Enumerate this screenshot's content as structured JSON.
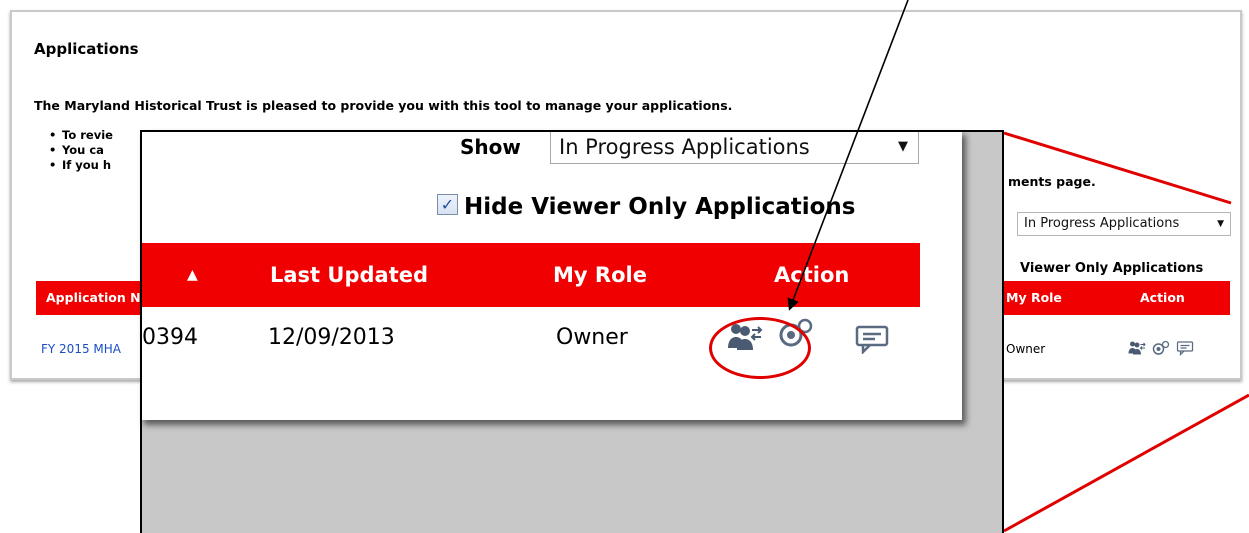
{
  "background": {
    "title": "Applications",
    "intro": "The Maryland Historical Trust is pleased to provide you with this tool to manage your applications.",
    "bullets": [
      "To revie",
      "You ca",
      "If you h"
    ],
    "documents_text": "ments page.",
    "show_select_value": "In Progress Applications",
    "hide_viewer_label": "Viewer Only Applications",
    "table_headers": {
      "application": "Application N",
      "role": "My Role",
      "action": "Action"
    },
    "row": {
      "application": "FY 2015 MHA",
      "role": "Owner"
    }
  },
  "zoom": {
    "show_label": "Show",
    "show_select_value": "In Progress Applications",
    "hide_viewer_checked": "✓",
    "hide_viewer_label": "Hide Viewer Only Applications",
    "table_headers": {
      "sort": "▲",
      "last_updated": "Last Updated",
      "role": "My Role",
      "action": "Action"
    },
    "row": {
      "id": "0394",
      "last_updated": "12/09/2013",
      "role": "Owner"
    }
  },
  "icons": [
    "transfer-users-icon",
    "manage-settings-icon",
    "comments-icon"
  ],
  "colors": {
    "header_red": "#f00000",
    "link_blue": "#1a4fc3",
    "annotation_red": "#e00000"
  }
}
